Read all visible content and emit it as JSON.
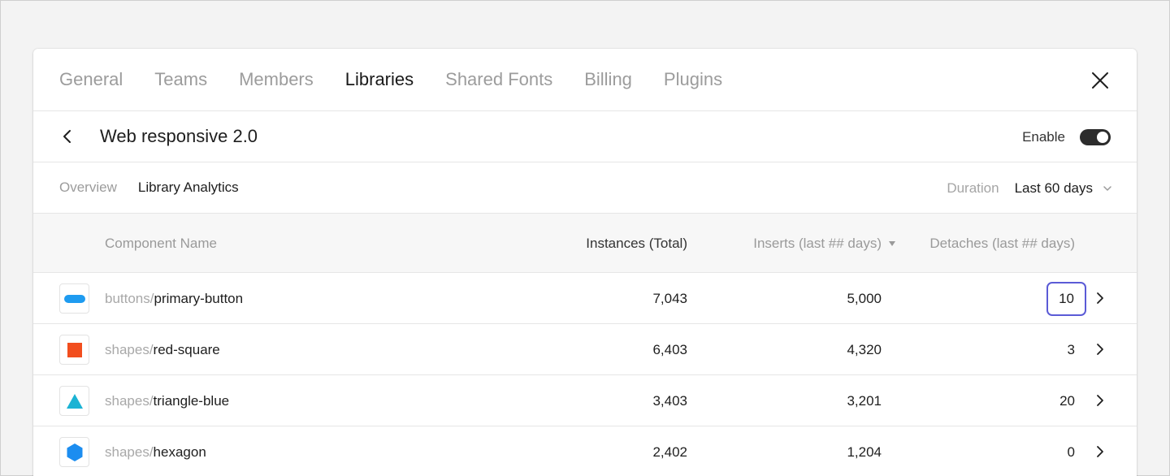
{
  "tabs": [
    {
      "label": "General",
      "active": false
    },
    {
      "label": "Teams",
      "active": false
    },
    {
      "label": "Members",
      "active": false
    },
    {
      "label": "Libraries",
      "active": true
    },
    {
      "label": "Shared Fonts",
      "active": false
    },
    {
      "label": "Billing",
      "active": false
    },
    {
      "label": "Plugins",
      "active": false
    }
  ],
  "library": {
    "title": "Web responsive 2.0",
    "enable_label": "Enable",
    "enabled": true
  },
  "subnav": {
    "tabs": [
      {
        "label": "Overview",
        "active": false
      },
      {
        "label": "Library Analytics",
        "active": true
      }
    ],
    "duration_label": "Duration",
    "duration_value": "Last 60 days"
  },
  "table": {
    "headers": {
      "name": "Component Name",
      "instances": "Instances (Total)",
      "inserts": "Inserts (last ## days)",
      "detaches": "Detaches (last ## days)"
    },
    "rows": [
      {
        "prefix": "buttons/",
        "base": "primary-button",
        "thumb": "pill-blue",
        "instances": "7,043",
        "inserts": "5,000",
        "detaches": "10",
        "highlight": true
      },
      {
        "prefix": "shapes/",
        "base": "red-square",
        "thumb": "square-red",
        "instances": "6,403",
        "inserts": "4,320",
        "detaches": "3",
        "highlight": false
      },
      {
        "prefix": "shapes/",
        "base": "triangle-blue",
        "thumb": "triangle-teal",
        "instances": "3,403",
        "inserts": "3,201",
        "detaches": "20",
        "highlight": false
      },
      {
        "prefix": "shapes/",
        "base": "hexagon",
        "thumb": "hexagon-blue",
        "instances": "2,402",
        "inserts": "1,204",
        "detaches": "0",
        "highlight": false
      }
    ]
  },
  "colors": {
    "pill_blue": "#1e9bf0",
    "square_red": "#f24e1e",
    "triangle_teal": "#1bb3d4",
    "hexagon_blue": "#1c8df0",
    "highlight_border": "#5b5bd6"
  }
}
